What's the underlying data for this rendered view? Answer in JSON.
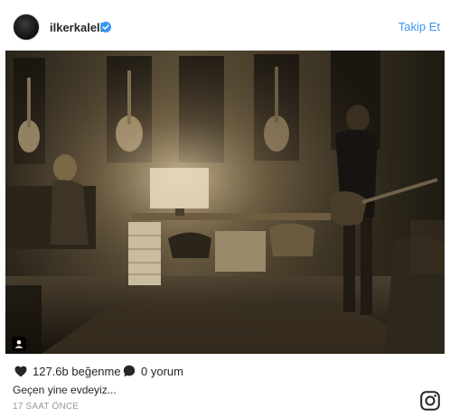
{
  "post": {
    "username": "ilkerkaleli",
    "verified": true,
    "follow_label": "Takip Et",
    "likes": "127.6b beğenme",
    "comments": "0 yorum",
    "caption": "Geçen yine evdeyiz...",
    "timestamp": "17 SAAT ÖNCE"
  },
  "icons": {
    "verified": "verified-badge-icon",
    "like": "heart-icon",
    "comment": "comment-bubble-icon",
    "tag": "user-tag-icon",
    "brand": "instagram-logo-icon"
  },
  "colors": {
    "link": "#3897f0",
    "text": "#262626",
    "muted": "#999999"
  }
}
